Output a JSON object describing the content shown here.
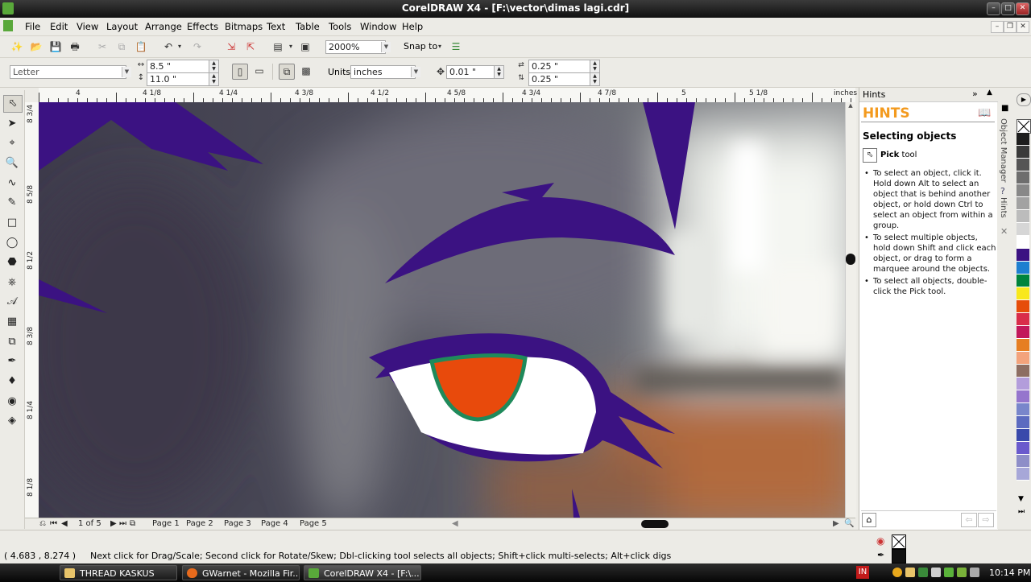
{
  "window": {
    "title": "CorelDRAW X4 - [F:\\vector\\dimas lagi.cdr]"
  },
  "menu": [
    "File",
    "Edit",
    "View",
    "Layout",
    "Arrange",
    "Effects",
    "Bitmaps",
    "Text",
    "Table",
    "Tools",
    "Window",
    "Help"
  ],
  "standard_toolbar": {
    "zoom": "2000%",
    "snap_label": "Snap to"
  },
  "property_bar": {
    "paper": "Letter",
    "width": "8.5 \"",
    "height": "11.0 \"",
    "units_label": "Units:",
    "units": "inches",
    "nudge": "0.01 \"",
    "dup_x": "0.25 \"",
    "dup_y": "0.25 \""
  },
  "horizontal_ruler": {
    "labels": [
      "4",
      "4 1/8",
      "4 1/4",
      "4 3/8",
      "4 1/2",
      "4 5/8",
      "4 3/4",
      "4 7/8",
      "5",
      "5 1/8"
    ],
    "unit": "inches"
  },
  "vertical_ruler": {
    "labels": [
      "8 3/4",
      "8 5/8",
      "8 1/2",
      "8 3/8",
      "8 1/4",
      "8 1/8"
    ],
    "unit": "inches"
  },
  "page_navigator": {
    "count": "1 of 5",
    "pages": [
      "Page 1",
      "Page 2",
      "Page 3",
      "Page 4",
      "Page 5"
    ]
  },
  "hints": {
    "panel_title": "Hints",
    "heading": "HINTS",
    "subheading": "Selecting objects",
    "tool_name": "Pick",
    "tool_suffix": " tool",
    "bullets": [
      "To select an object, click it. Hold down Alt to select an object that is behind another object, or hold down Ctrl to select an object from within a group.",
      "To select multiple objects, hold down Shift and click each object, or drag to form a marquee around the objects.",
      "To select all objects, double-click the Pick tool."
    ]
  },
  "docker_tabs": [
    "Object Manager",
    "Hints"
  ],
  "palette": [
    "#1e1e1e",
    "#3a3a3a",
    "#555555",
    "#6e6e6e",
    "#888888",
    "#a2a2a2",
    "#bcbcbc",
    "#d6d6d6",
    "#ffffff",
    "#3b1282",
    "#1e7fd0",
    "#00843c",
    "#f8e81c",
    "#e64d0a",
    "#d92c4a",
    "#c2185b",
    "#e67e22",
    "#f3a37c",
    "#8d6e63",
    "#b39ddb",
    "#9575cd",
    "#7986cb",
    "#5c6bc0",
    "#3949ab",
    "#6a5acd",
    "#8e8ec8",
    "#a7a7d8"
  ],
  "status": {
    "coords": "( 4.683 , 8.274 )",
    "message": "Next click for Drag/Scale; Second click for Rotate/Skew; Dbl-clicking tool selects all objects; Shift+click multi-selects; Alt+click digs"
  },
  "taskbar": {
    "tasks": [
      "THREAD KASKUS",
      "GWarnet - Mozilla Fir...",
      "CorelDRAW X4 - [F:\\..."
    ],
    "lang": "IN",
    "time": "10:14 PM"
  },
  "colors": {
    "purple": "#3b1282",
    "iris": "#e84a0c",
    "iris_ring": "#1f8a5b"
  }
}
